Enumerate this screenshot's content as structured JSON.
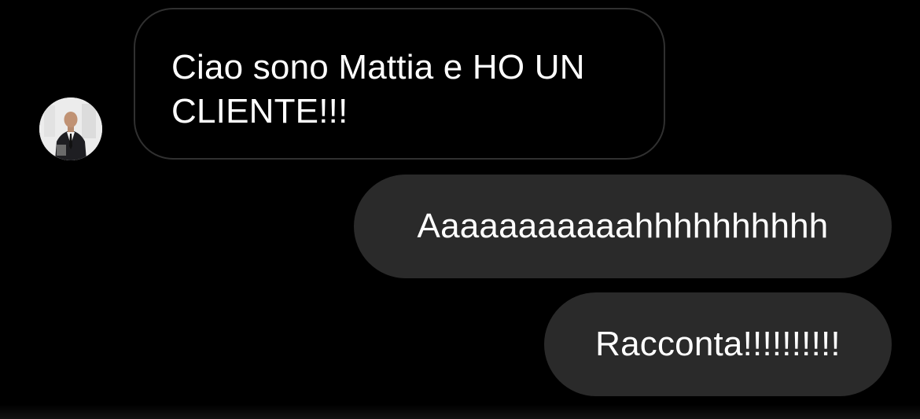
{
  "conversation": {
    "messages": [
      {
        "direction": "incoming",
        "text": "Ciao sono Mattia e HO UN CLIENTE!!!"
      },
      {
        "direction": "outgoing",
        "text": "Aaaaaaaaaaahhhhhhhhhh"
      },
      {
        "direction": "outgoing",
        "text": "Racconta!!!!!!!!!!"
      }
    ],
    "sender_avatar": {
      "icon": "person-in-suit-photo"
    }
  },
  "colors": {
    "background": "#000000",
    "incoming_bubble_border": "#303030",
    "outgoing_bubble_fill": "#2a2a2a",
    "text": "#ffffff"
  }
}
